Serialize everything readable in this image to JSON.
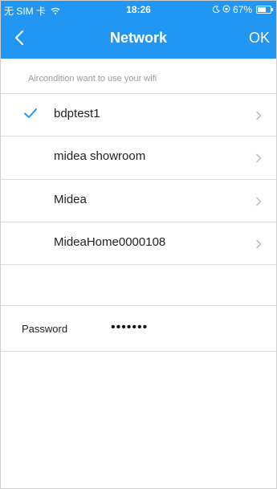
{
  "status_bar": {
    "carrier": "无 SIM 卡",
    "time": "18:26",
    "battery": "67%",
    "battery_level": 0.67,
    "icons": [
      "wifi-icon",
      "moon-icon",
      "orientation-lock-icon",
      "battery-icon"
    ]
  },
  "nav": {
    "back_icon": "chevron-left-icon",
    "title": "Network",
    "ok_label": "OK"
  },
  "hint": "Aircondition want to use your wifi",
  "networks": [
    {
      "name": "bdptest1",
      "selected": true
    },
    {
      "name": "midea showroom",
      "selected": false
    },
    {
      "name": "Midea",
      "selected": false
    },
    {
      "name": "MideaHome0000108",
      "selected": false
    }
  ],
  "password": {
    "label": "Password",
    "value": "•••••••"
  },
  "colors": {
    "accent": "#2196f3",
    "divider": "#dcdcdc",
    "hint": "#9a9a9a"
  }
}
